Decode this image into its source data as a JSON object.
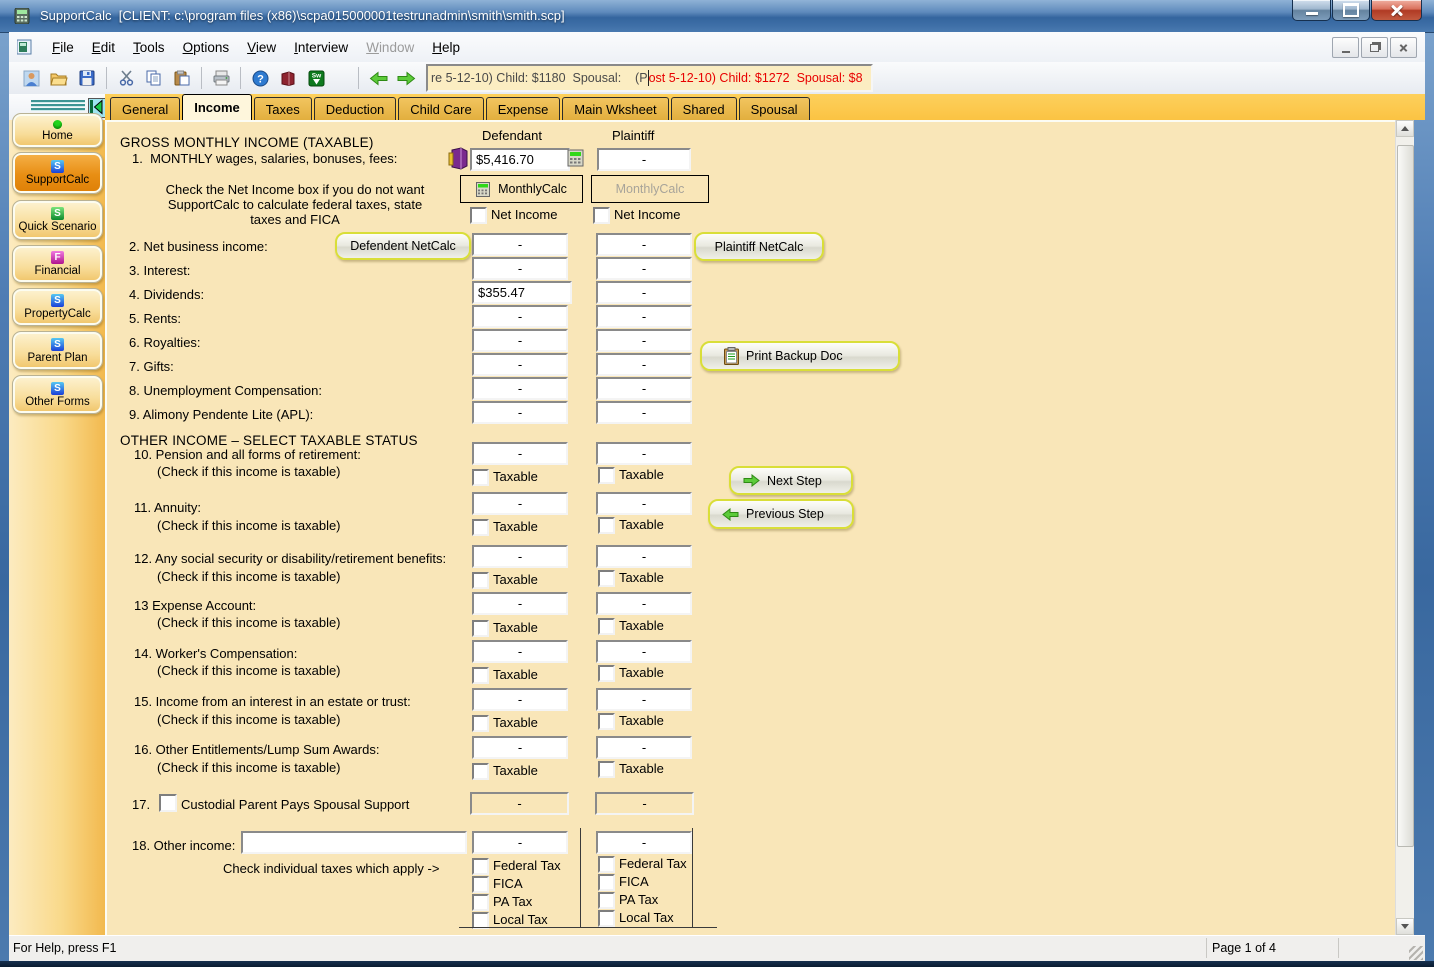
{
  "window": {
    "title": "SupportCalc  [CLIENT: c:\\program files (x86)\\scpa015000001testrunadmin\\smith\\smith.scp]"
  },
  "menu": {
    "items": [
      "File",
      "Edit",
      "Tools",
      "Options",
      "View",
      "Interview",
      "Window",
      "Help"
    ],
    "disabled_item": "Window"
  },
  "toolbar": {
    "status_field": {
      "text_black": "re 5-12-10) Child: $1180  Spousal:    (P",
      "text_red": "ost 5-12-10) Child: $1272  Spousal: $8"
    }
  },
  "tabs": {
    "items": [
      "General",
      "Income",
      "Taxes",
      "Deduction",
      "Child Care",
      "Expense",
      "Main Wksheet",
      "Shared",
      "Spousal"
    ],
    "active": "Income"
  },
  "sidebar": {
    "items": [
      "Home",
      "SupportCalc",
      "Quick Scenario",
      "Financial",
      "PropertyCalc",
      "Parent Plan",
      "Other Forms"
    ],
    "active": "SupportCalc"
  },
  "form": {
    "section1_title": "GROSS MONTHLY INCOME (TAXABLE)",
    "columns": {
      "defendant": "Defendant",
      "plaintiff": "Plaintiff"
    },
    "row1": {
      "label": "1.  MONTHLY wages, salaries, bonuses, fees:",
      "defendant": "$5,416.70",
      "plaintiff": "-"
    },
    "monthlycalc": "MonthlyCalc",
    "net_income": "Net Income",
    "note": [
      "Check the Net Income box if you do not want",
      "SupportCalc to calculate federal taxes, state",
      "taxes and FICA"
    ],
    "defendant_netcalc": "Defendent NetCalc",
    "plaintiff_netcalc": "Plaintiff NetCalc",
    "print_backup": "Print Backup Doc",
    "next_step": "Next Step",
    "previous_step": "Previous Step",
    "simple_rows": [
      {
        "label": "2. Net business income:",
        "defendant": "-",
        "plaintiff": "-"
      },
      {
        "label": "3. Interest:",
        "defendant": "-",
        "plaintiff": "-"
      },
      {
        "label": "4. Dividends:",
        "defendant": "$355.47",
        "plaintiff": "-"
      },
      {
        "label": "5. Rents:",
        "defendant": "-",
        "plaintiff": "-"
      },
      {
        "label": "6. Royalties:",
        "defendant": "-",
        "plaintiff": "-"
      },
      {
        "label": "7. Gifts:",
        "defendant": "-",
        "plaintiff": "-"
      },
      {
        "label": "8. Unemployment Compensation:",
        "defendant": "-",
        "plaintiff": "-"
      },
      {
        "label": "9. Alimony Pendente Lite (APL):",
        "defendant": "-",
        "plaintiff": "-"
      }
    ],
    "section2_title": "OTHER INCOME – SELECT TAXABLE STATUS",
    "taxable_note": "(Check if this income is taxable)",
    "taxable_label": "Taxable",
    "taxable_rows": [
      {
        "label": "10. Pension and all forms of retirement:",
        "defendant": "-",
        "plaintiff": "-"
      },
      {
        "label": "11. Annuity:",
        "defendant": "-",
        "plaintiff": "-"
      },
      {
        "label": "12. Any social security or disability/retirement benefits:",
        "defendant": "-",
        "plaintiff": "-"
      },
      {
        "label": "13 Expense Account:",
        "defendant": "-",
        "plaintiff": "-"
      },
      {
        "label": "14. Worker's Compensation:",
        "defendant": "-",
        "plaintiff": "-"
      },
      {
        "label": "15. Income from an interest in an estate or trust:",
        "defendant": "-",
        "plaintiff": "-"
      },
      {
        "label": "16. Other Entitlements/Lump Sum Awards:",
        "defendant": "-",
        "plaintiff": "-"
      }
    ],
    "row17": {
      "number": "17.",
      "label": "Custodial Parent Pays Spousal Support",
      "defendant": "-",
      "plaintiff": "-"
    },
    "row18": {
      "label": "18. Other income:",
      "other_text": "",
      "defendant": "-",
      "plaintiff": "-"
    },
    "tax_apply_note": "Check individual taxes which apply ->",
    "tax_checks": [
      "Federal Tax",
      "FICA",
      "PA Tax",
      "Local Tax"
    ]
  },
  "statusbar": {
    "help": "For Help, press F1",
    "page": "Page 1 of 4"
  },
  "colors": {
    "tab_gold": "#FBC84E",
    "content_bg": "#F9E6B8",
    "active_sidebar": "#E8920F",
    "status_red": "#E80000"
  }
}
